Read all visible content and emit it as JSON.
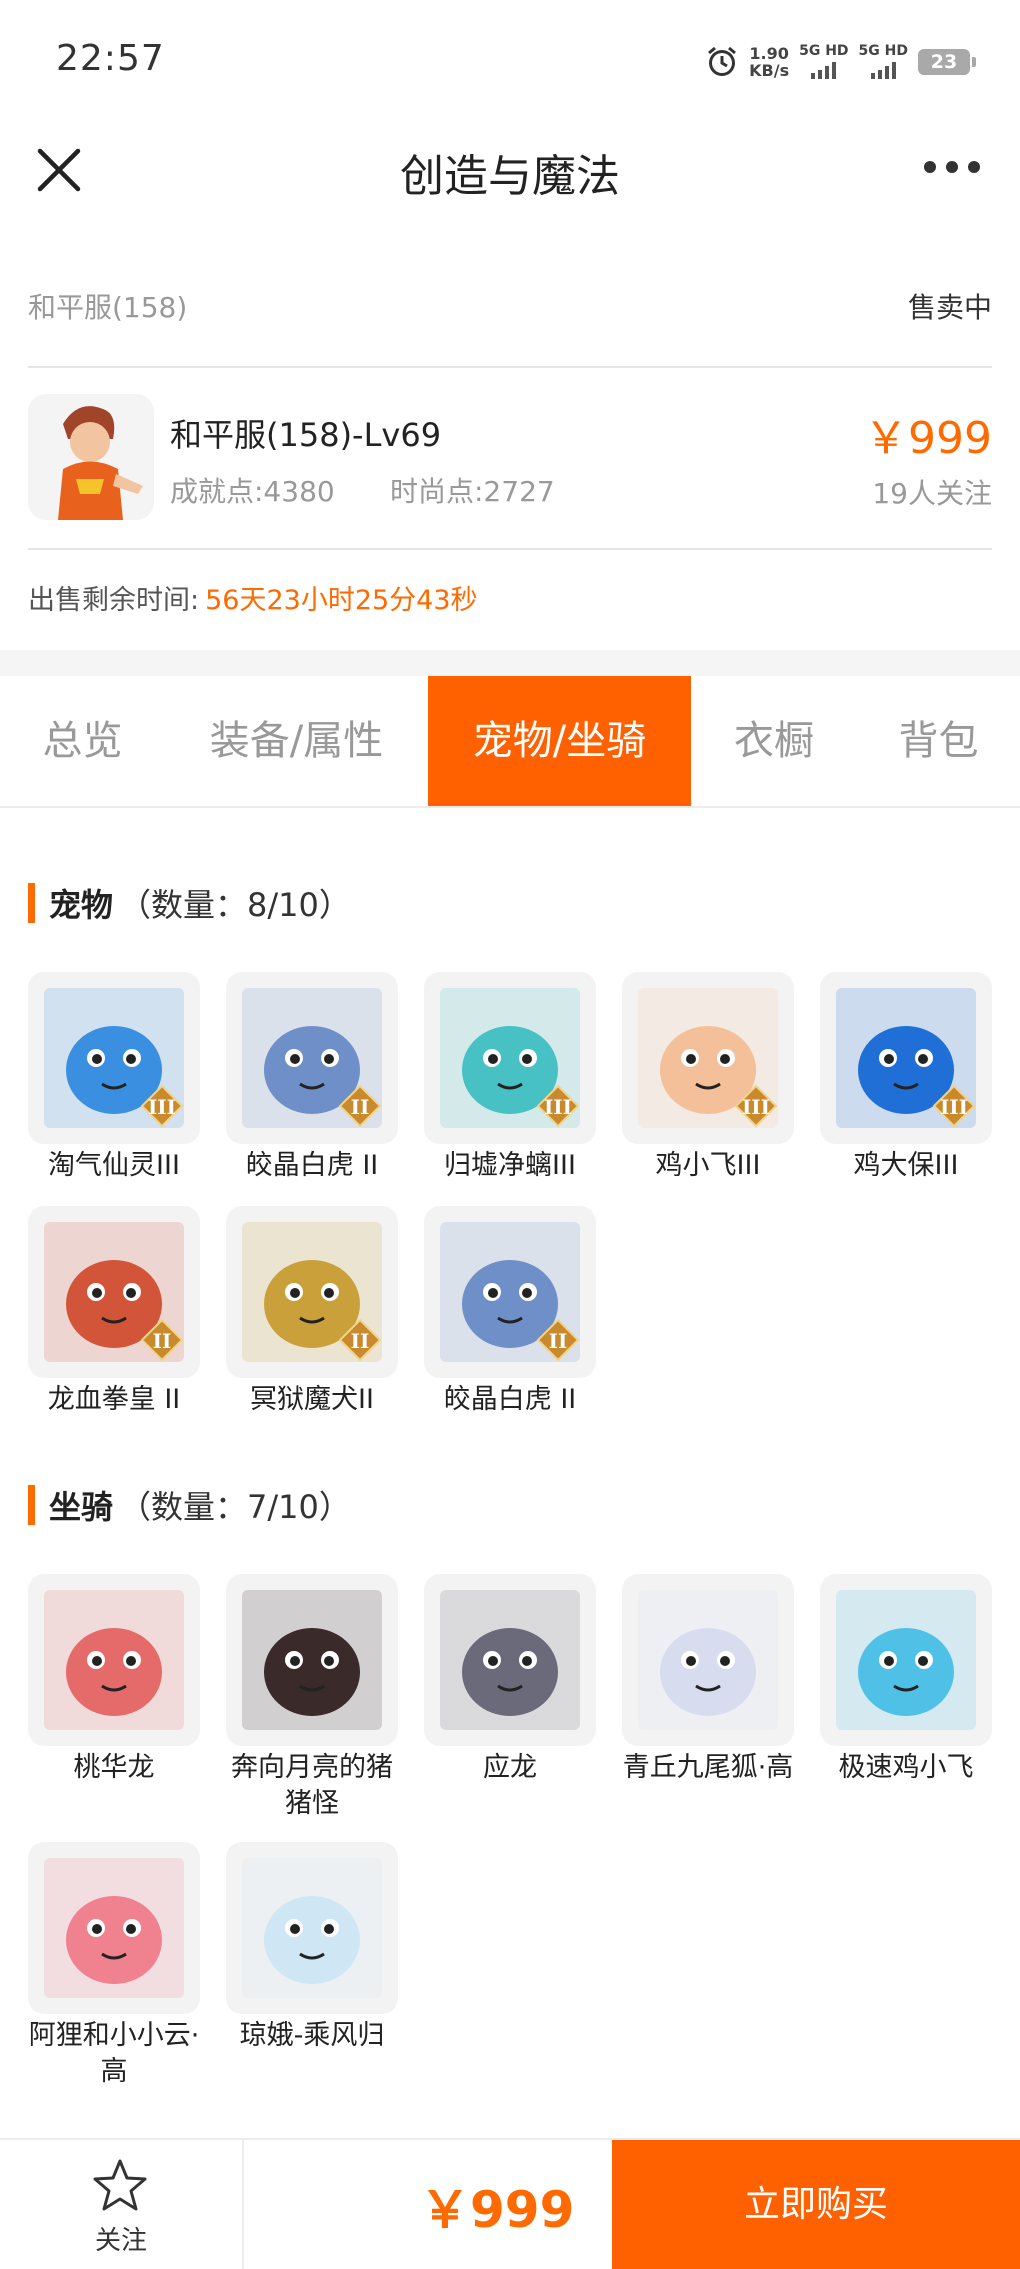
{
  "status_bar": {
    "time": "22:57",
    "speed_value": "1.90",
    "speed_unit": "KB/s",
    "signal1": "5G HD",
    "signal2": "5G HD",
    "battery": "23"
  },
  "nav": {
    "title": "创造与魔法"
  },
  "listing": {
    "server": "和平服(158)",
    "status": "售卖中",
    "char_name": "和平服(158)-Lv69",
    "achievement": "成就点:4380",
    "fashion": "时尚点:2727",
    "price": "￥999",
    "followers": "19人关注",
    "countdown_label": "出售剩余时间:",
    "countdown_value": "56天23小时25分43秒"
  },
  "tabs": [
    "总览",
    "装备/属性",
    "宠物/坐骑",
    "衣橱",
    "背包"
  ],
  "active_tab": "宠物/坐骑",
  "pets": {
    "title": "宠物",
    "count": "（数量：8/10）",
    "items": [
      {
        "name": "淘气仙灵III",
        "color": "#3a8fe0",
        "tier": "III"
      },
      {
        "name": "皎晶白虎 II",
        "color": "#6f8fc8",
        "tier": "II"
      },
      {
        "name": "归墟净螭III",
        "color": "#47c1c4",
        "tier": "III"
      },
      {
        "name": "鸡小飞III",
        "color": "#f3c09a",
        "tier": "III"
      },
      {
        "name": "鸡大保III",
        "color": "#1f6fd6",
        "tier": "III"
      },
      {
        "name": "龙血拳皇 II",
        "color": "#d2553a",
        "tier": "II"
      },
      {
        "name": "冥狱魔犬II",
        "color": "#c9a03a",
        "tier": "II"
      },
      {
        "name": "皎晶白虎 II",
        "color": "#6f8fc8",
        "tier": "II"
      }
    ]
  },
  "mounts": {
    "title": "坐骑",
    "count": "（数量：7/10）",
    "items": [
      {
        "name": "桃华龙",
        "color": "#e56a6a"
      },
      {
        "name": "奔向月亮的猪猪怪",
        "color": "#3a2a2a"
      },
      {
        "name": "应龙",
        "color": "#6a6a7a"
      },
      {
        "name": "青丘九尾狐·高",
        "color": "#d8dcef"
      },
      {
        "name": "极速鸡小飞",
        "color": "#4fc1e6"
      },
      {
        "name": "阿狸和小小云·高",
        "color": "#f0828f"
      },
      {
        "name": "琼娥-乘风归",
        "color": "#cfe6f5"
      }
    ]
  },
  "bottom_bar": {
    "follow": "关注",
    "price": "￥999",
    "buy": "立即购买"
  },
  "colors": {
    "accent": "#ff6000",
    "price": "#ff6a00"
  }
}
